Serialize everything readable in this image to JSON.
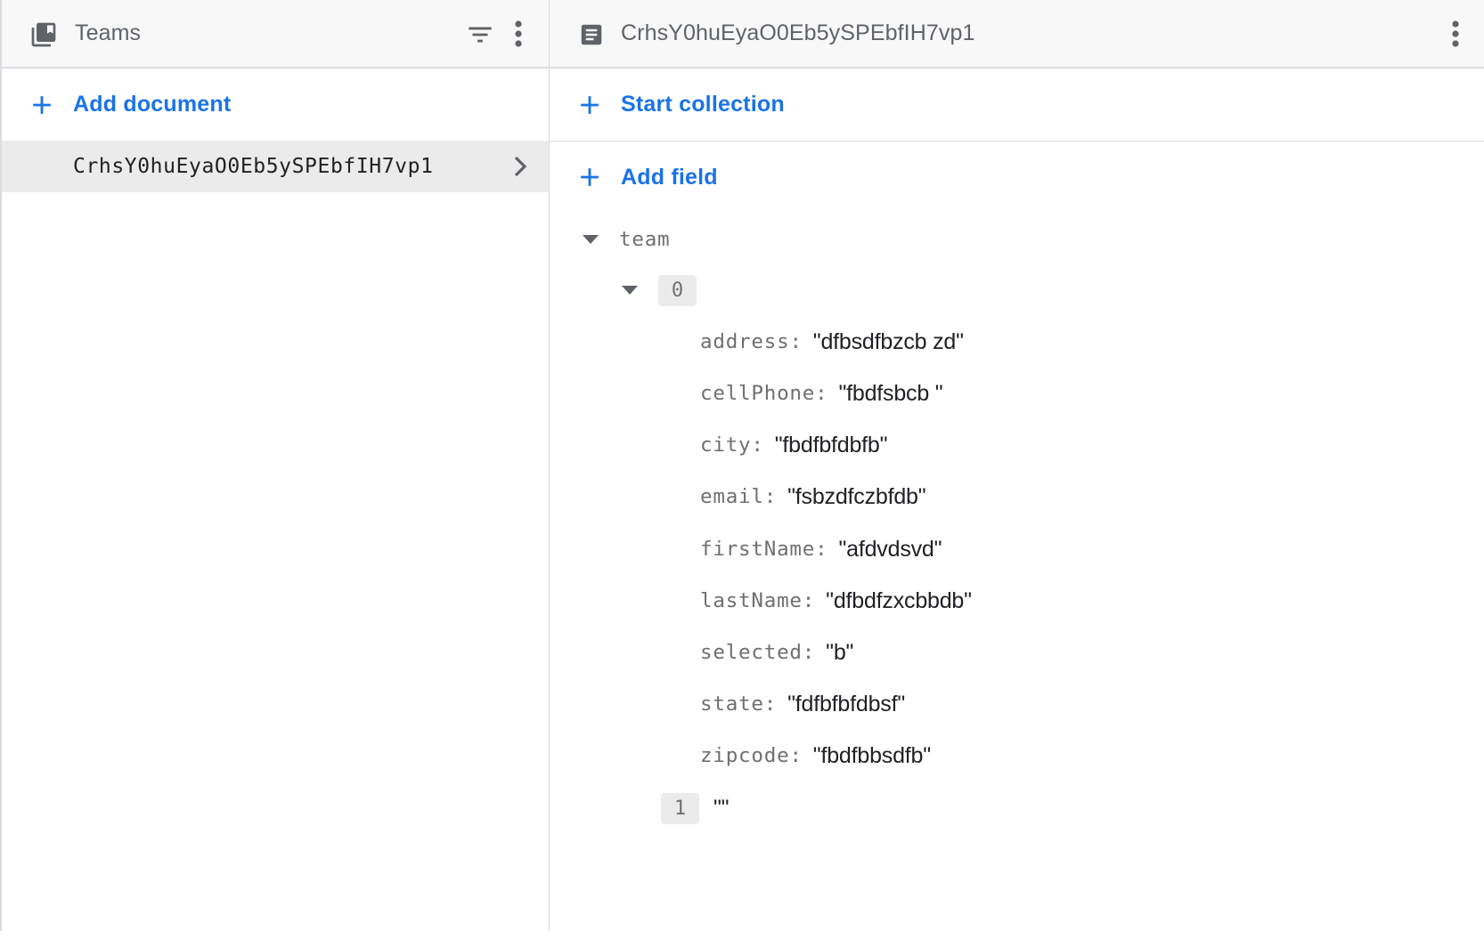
{
  "collection_pane": {
    "title": "Teams",
    "icons": {
      "collection": "collection-icon",
      "filter": "filter-icon",
      "more": "more-vert-icon"
    },
    "add_document_label": "Add document",
    "documents": [
      {
        "id": "CrhsY0huEyaO0Eb5ySPEbfIH7vp1",
        "selected": true
      }
    ]
  },
  "document_pane": {
    "title": "CrhsY0huEyaO0Eb5ySPEbfIH7vp1",
    "icons": {
      "document": "document-icon",
      "more": "more-vert-icon"
    },
    "start_collection_label": "Start collection",
    "add_field_label": "Add field",
    "fields": [
      {
        "key": "team",
        "type": "array",
        "expanded": true,
        "items": [
          {
            "index": "0",
            "type": "map",
            "expanded": true,
            "entries": [
              {
                "key": "address",
                "value": "\"dfbsdfbzcb zd\""
              },
              {
                "key": "cellPhone",
                "value": "\"fbdfsbcb \""
              },
              {
                "key": "city",
                "value": "\"fbdfbfdbfb\""
              },
              {
                "key": "email",
                "value": "\"fsbzdfczbfdb\""
              },
              {
                "key": "firstName",
                "value": "\"afdvdsvd\""
              },
              {
                "key": "lastName",
                "value": "\"dfbdfzxcbbdb\""
              },
              {
                "key": "selected",
                "value": "\"b\""
              },
              {
                "key": "state",
                "value": "\"fdfbfbfdbsf\""
              },
              {
                "key": "zipcode",
                "value": "\"fbdfbbsdfb\""
              }
            ]
          },
          {
            "index": "1",
            "type": "string",
            "value": "\"\""
          }
        ]
      }
    ]
  },
  "colors": {
    "accent": "#1a73e8",
    "header_bg": "#f8f8f8",
    "selected_row_bg": "#ebebeb",
    "icon_gray": "#5f6368",
    "key_gray": "#6f6f6f",
    "divider": "#dadce0"
  }
}
